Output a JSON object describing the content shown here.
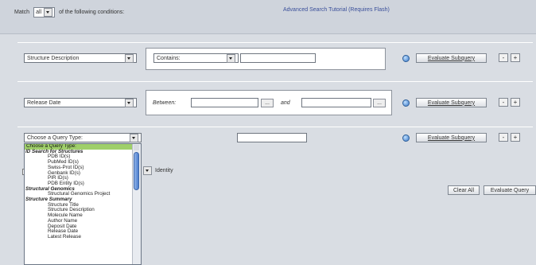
{
  "header": {
    "match_prefix": "Match",
    "match_value": "all",
    "match_suffix": "of the following conditions:",
    "tutorial_link": "Advanced Search Tutorial (Requires Flash)"
  },
  "queries": [
    {
      "type": "Structure Description",
      "operator": "Contains:",
      "value": "",
      "evaluate_label": "Evaluate Subquery"
    },
    {
      "type": "Release Date",
      "between_label": "Between:",
      "and_label": "and",
      "from_value": "",
      "to_value": "",
      "dots_label": "...",
      "evaluate_label": "Evaluate Subquery"
    },
    {
      "type": "Choose a Query Type:",
      "value": "",
      "evaluate_label": "Evaluate Subquery"
    }
  ],
  "plus_label": "+",
  "minus_label": "-",
  "dropdown": {
    "items": [
      {
        "label": "Choose a Query Type:",
        "kind": "selected"
      },
      {
        "label": "ID Search for Structures",
        "kind": "group"
      },
      {
        "label": "PDB ID(s)",
        "kind": "sub"
      },
      {
        "label": "PubMed ID(s)",
        "kind": "sub"
      },
      {
        "label": "Swiss-Prot ID(s)",
        "kind": "sub"
      },
      {
        "label": "Genbank ID(s)",
        "kind": "sub"
      },
      {
        "label": "PIR ID(s)",
        "kind": "sub"
      },
      {
        "label": "PDB Entity ID(s)",
        "kind": "sub"
      },
      {
        "label": "Structural Genomics",
        "kind": "group"
      },
      {
        "label": "Structural Genomics Project",
        "kind": "sub"
      },
      {
        "label": "Structure Summary",
        "kind": "group"
      },
      {
        "label": "Structure Title",
        "kind": "sub"
      },
      {
        "label": "Structure Description",
        "kind": "sub"
      },
      {
        "label": "Molecule Name",
        "kind": "sub"
      },
      {
        "label": "Author Name",
        "kind": "sub"
      },
      {
        "label": "Deposit Date",
        "kind": "sub"
      },
      {
        "label": "Release Date",
        "kind": "sub"
      },
      {
        "label": "Latest Release",
        "kind": "sub"
      }
    ]
  },
  "identity_label": "Identity",
  "footer": {
    "clear_label": "Clear All",
    "evaluate_query_label": "Evaluate Query"
  }
}
